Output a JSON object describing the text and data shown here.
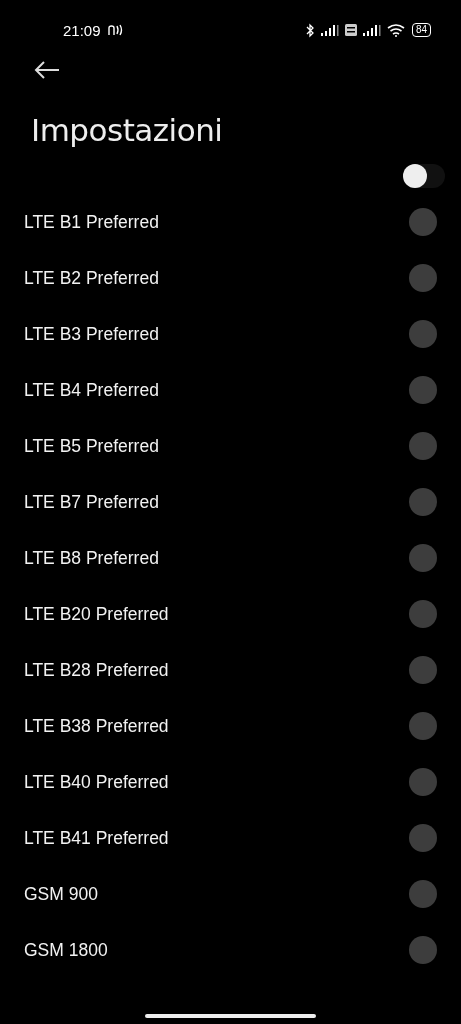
{
  "status_bar": {
    "time": "21:09",
    "battery": "84"
  },
  "title": "Impostazioni",
  "master_switch": {
    "on": false
  },
  "bands": [
    {
      "label": "LTE B1 Preferred",
      "selected": false
    },
    {
      "label": "LTE B2 Preferred",
      "selected": false
    },
    {
      "label": "LTE B3 Preferred",
      "selected": false
    },
    {
      "label": "LTE B4 Preferred",
      "selected": false
    },
    {
      "label": "LTE B5 Preferred",
      "selected": false
    },
    {
      "label": "LTE B7 Preferred",
      "selected": false
    },
    {
      "label": "LTE B8 Preferred",
      "selected": false
    },
    {
      "label": "LTE B20 Preferred",
      "selected": false
    },
    {
      "label": "LTE B28 Preferred",
      "selected": false
    },
    {
      "label": "LTE B38 Preferred",
      "selected": false
    },
    {
      "label": "LTE B40 Preferred",
      "selected": false
    },
    {
      "label": "LTE B41 Preferred",
      "selected": false
    },
    {
      "label": "GSM 900",
      "selected": false
    },
    {
      "label": "GSM 1800",
      "selected": false
    }
  ]
}
